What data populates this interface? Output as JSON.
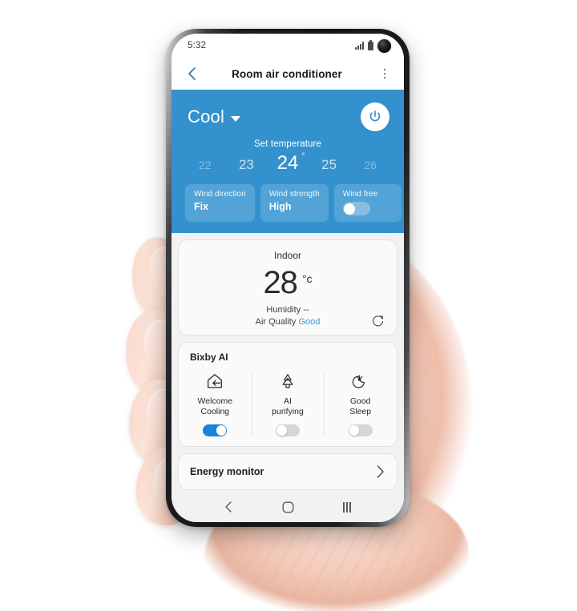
{
  "device": {
    "frame": "samsung-galaxy-s10",
    "held_by": "hand"
  },
  "status_bar": {
    "time": "5:32",
    "icons": [
      "signal-icon",
      "battery-icon",
      "front-camera"
    ]
  },
  "app_bar": {
    "back_icon": "chevron-left-icon",
    "title": "Room air conditioner",
    "more_icon": "more-vertical-icon"
  },
  "control_panel": {
    "accent_color": "#3392ce",
    "mode": "Cool",
    "mode_caret": "caret-down-icon",
    "power_icon": "power-icon",
    "power_state": "on",
    "set_temperature_label": "Set temperature",
    "temperatures": [
      {
        "value": "22",
        "state": "far"
      },
      {
        "value": "23",
        "state": "near"
      },
      {
        "value": "24",
        "state": "selected",
        "degree": "°"
      },
      {
        "value": "25",
        "state": "near"
      },
      {
        "value": "26",
        "state": "far"
      }
    ],
    "selected_temperature": "24",
    "chips": [
      {
        "title": "Wind direction",
        "value": "Fix",
        "type": "value"
      },
      {
        "title": "Wind strength",
        "value": "High",
        "type": "value"
      },
      {
        "title": "Wind free",
        "value": "",
        "type": "toggle",
        "toggle_state": "off"
      }
    ]
  },
  "indoor_card": {
    "title": "Indoor",
    "temperature": "28",
    "unit": "°c",
    "humidity_label": "Humidity",
    "humidity_value": "--",
    "air_quality_label": "Air Quality",
    "air_quality_value": "Good",
    "air_quality_color": "#2f9fd8",
    "refresh_icon": "refresh-icon"
  },
  "bixby_card": {
    "title": "Bixby AI",
    "items": [
      {
        "icon": "home-arrow-in-icon",
        "label_line1": "Welcome",
        "label_line2": "Cooling",
        "toggle_state": "on"
      },
      {
        "icon": "pine-tree-icon",
        "label_line1": "AI",
        "label_line2": "purifying",
        "toggle_state": "off"
      },
      {
        "icon": "moon-sparkle-icon",
        "label_line1": "Good",
        "label_line2": "Sleep",
        "toggle_state": "off"
      }
    ],
    "toggle_on_color": "#1b84d8",
    "toggle_off_color": "#d4d6d8"
  },
  "energy_card": {
    "label": "Energy monitor",
    "chevron_icon": "chevron-right-icon"
  },
  "nav_bar": {
    "back_icon": "nav-back-icon",
    "home_icon": "nav-home-icon",
    "recents_icon": "nav-recents-icon"
  }
}
